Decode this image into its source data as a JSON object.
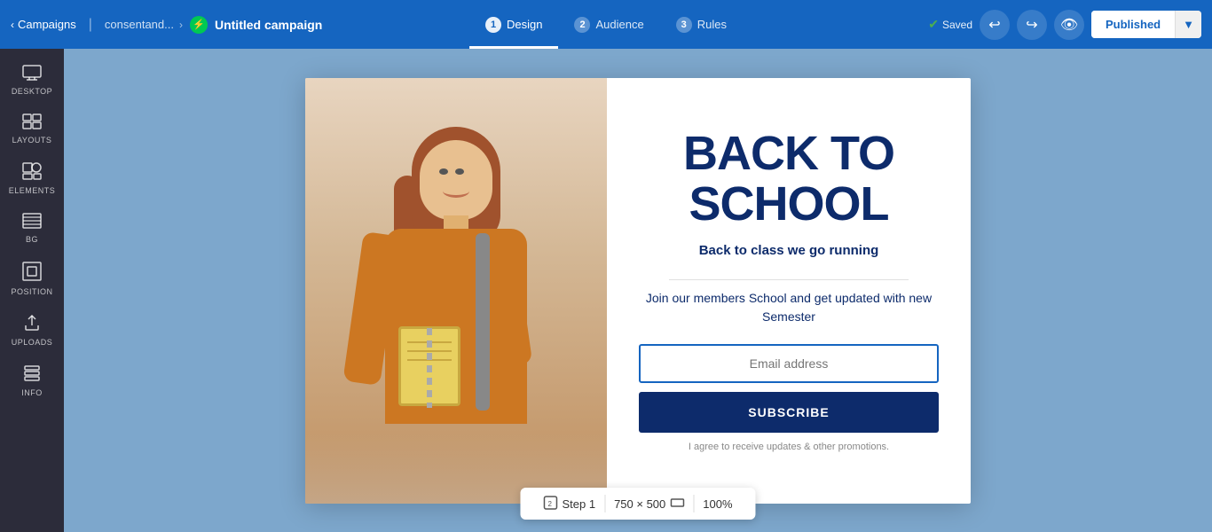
{
  "nav": {
    "campaigns_label": "Campaigns",
    "breadcrumb_org": "consentand...",
    "campaign_title": "Untitled campaign",
    "tab_design": "Design",
    "tab_audience": "Audience",
    "tab_rules": "Rules",
    "tab_design_num": "1",
    "tab_audience_num": "2",
    "tab_rules_num": "3",
    "saved_label": "Saved",
    "publish_label": "Published"
  },
  "sidebar": {
    "items": [
      {
        "id": "desktop",
        "icon": "🖥",
        "label": "DESKTOP"
      },
      {
        "id": "layouts",
        "icon": "⊞",
        "label": "LAYOUTS"
      },
      {
        "id": "elements",
        "icon": "⬚",
        "label": "ELEMENTS"
      },
      {
        "id": "bg",
        "icon": "▤",
        "label": "BG"
      },
      {
        "id": "position",
        "icon": "⬜",
        "label": "POSITION"
      },
      {
        "id": "uploads",
        "icon": "⬆",
        "label": "UPLOADS"
      },
      {
        "id": "info",
        "icon": "⌨",
        "label": "INFO"
      }
    ]
  },
  "popup": {
    "title": "BACK TO SCHOOL",
    "subtitle": "Back to class we go running",
    "description": "Join our members School and get updated with new Semester",
    "email_placeholder": "Email address",
    "subscribe_label": "SUBSCRIBE",
    "agree_text": "I agree to receive updates & other promotions."
  },
  "bottom_bar": {
    "step_label": "Step 1",
    "dimensions": "750 × 500",
    "zoom": "100%"
  }
}
